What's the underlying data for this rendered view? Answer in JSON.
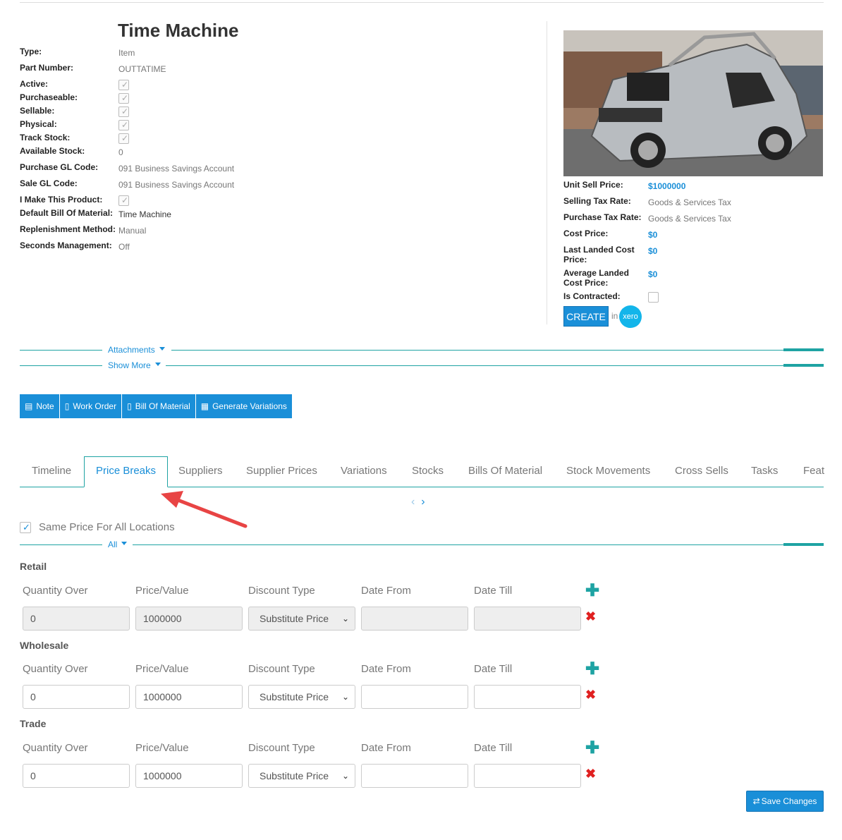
{
  "product": {
    "title": "Time Machine",
    "fields": [
      {
        "label": "Type:",
        "value": "Item"
      },
      {
        "label": "Part Number:",
        "value": "OUTTATIME"
      },
      {
        "label": "Active:"
      },
      {
        "label": "Purchaseable:"
      },
      {
        "label": "Sellable:"
      },
      {
        "label": "Physical:"
      },
      {
        "label": "Track Stock:"
      },
      {
        "label": "Available Stock:",
        "value": "0"
      },
      {
        "label": "Purchase GL Code:",
        "value": "091 Business Savings Account"
      },
      {
        "label": "Sale GL Code:",
        "value": "091 Business Savings Account"
      },
      {
        "label": "I Make This Product:"
      },
      {
        "label": "Default Bill Of Material:",
        "value": "Time Machine"
      },
      {
        "label": "Replenishment Method:",
        "value": "Manual"
      },
      {
        "label": "Seconds Management:",
        "value": "Off"
      }
    ]
  },
  "pricing": {
    "fields": [
      {
        "label": "Unit Sell Price:",
        "value": "$1000000"
      },
      {
        "label": "Selling Tax Rate:",
        "value": "Goods & Services Tax"
      },
      {
        "label": "Purchase Tax Rate:",
        "value": "Goods & Services Tax"
      },
      {
        "label": "Cost Price:",
        "value": "$0"
      },
      {
        "label": "Last Landed Cost Price:",
        "value": "$0"
      },
      {
        "label": "Average Landed Cost Price:",
        "value": "$0"
      },
      {
        "label": "Is Contracted:"
      }
    ],
    "create_label": "CREATE",
    "in_label": "in",
    "xero_label": "xero"
  },
  "sections": {
    "attachments": "Attachments",
    "show_more": "Show More",
    "all": "All"
  },
  "actions": [
    "Note",
    "Work Order",
    "Bill Of Material",
    "Generate Variations"
  ],
  "tabs": [
    "Timeline",
    "Price Breaks",
    "Suppliers",
    "Supplier Prices",
    "Variations",
    "Stocks",
    "Bills Of Material",
    "Stock Movements",
    "Cross Sells",
    "Tasks",
    "Feat"
  ],
  "same_price_label": "Same Price For All Locations",
  "columns": [
    "Quantity Over",
    "Price/Value",
    "Discount Type",
    "Date From",
    "Date Till"
  ],
  "groups": [
    {
      "name": "Retail",
      "quantity": "0",
      "price": "1000000",
      "discount": "Substitute Price",
      "date_from": "",
      "date_till": "",
      "disabled": true
    },
    {
      "name": "Wholesale",
      "quantity": "0",
      "price": "1000000",
      "discount": "Substitute Price",
      "date_from": "",
      "date_till": "",
      "disabled": false
    },
    {
      "name": "Trade",
      "quantity": "0",
      "price": "1000000",
      "discount": "Substitute Price",
      "date_from": "",
      "date_till": "",
      "disabled": false
    }
  ],
  "save_label": "Save Changes",
  "colors": {
    "accent": "#1a8fd8",
    "teal": "#1ea3a3",
    "delete": "#e02020"
  }
}
